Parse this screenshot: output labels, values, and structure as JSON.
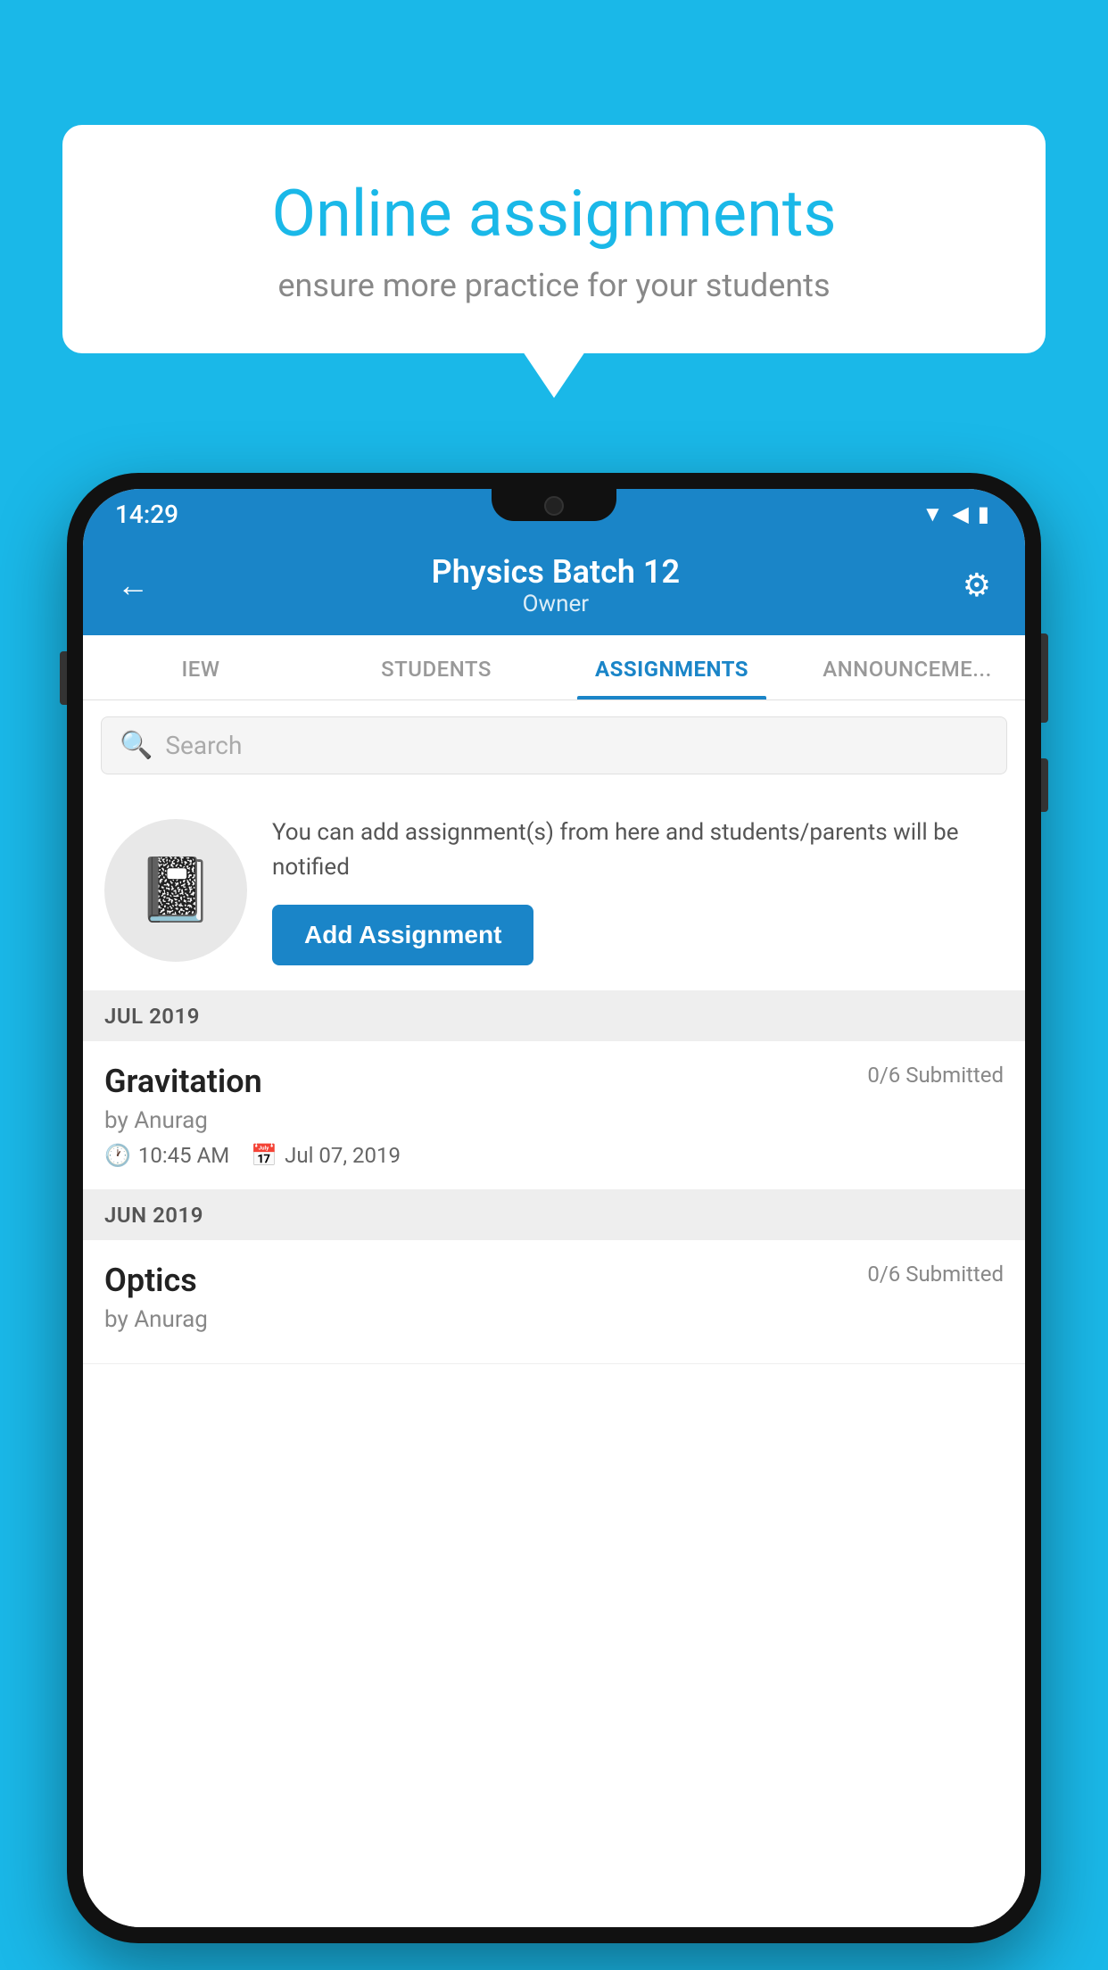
{
  "background": {
    "color": "#1ab8e8"
  },
  "promo": {
    "title": "Online assignments",
    "subtitle": "ensure more practice for your students"
  },
  "phone": {
    "status_bar": {
      "time": "14:29",
      "icons": [
        "wifi",
        "signal",
        "battery"
      ]
    },
    "header": {
      "title": "Physics Batch 12",
      "subtitle": "Owner",
      "back_label": "←",
      "settings_label": "⚙"
    },
    "tabs": [
      {
        "label": "IEW",
        "active": false
      },
      {
        "label": "STUDENTS",
        "active": false
      },
      {
        "label": "ASSIGNMENTS",
        "active": true
      },
      {
        "label": "ANNOUNCEMENTS",
        "active": false
      }
    ],
    "search": {
      "placeholder": "Search"
    },
    "assignment_promo": {
      "description": "You can add assignment(s) from here and students/parents will be notified",
      "button_label": "Add Assignment"
    },
    "sections": [
      {
        "month": "JUL 2019",
        "assignments": [
          {
            "name": "Gravitation",
            "submitted": "0/6 Submitted",
            "by": "by Anurag",
            "time": "10:45 AM",
            "date": "Jul 07, 2019"
          }
        ]
      },
      {
        "month": "JUN 2019",
        "assignments": [
          {
            "name": "Optics",
            "submitted": "0/6 Submitted",
            "by": "by Anurag",
            "time": "",
            "date": ""
          }
        ]
      }
    ]
  }
}
